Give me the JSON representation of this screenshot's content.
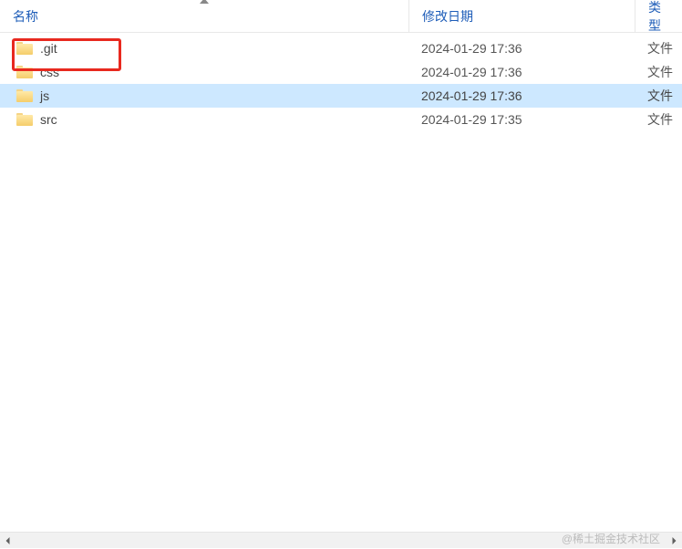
{
  "columns": {
    "name": "名称",
    "modified": "修改日期",
    "type": "类型"
  },
  "files": [
    {
      "name": ".git",
      "modified": "2024-01-29 17:36",
      "type": "文件",
      "selected": false,
      "highlighted": true
    },
    {
      "name": "css",
      "modified": "2024-01-29 17:36",
      "type": "文件",
      "selected": false,
      "highlighted": false
    },
    {
      "name": "js",
      "modified": "2024-01-29 17:36",
      "type": "文件",
      "selected": true,
      "highlighted": false
    },
    {
      "name": "src",
      "modified": "2024-01-29 17:35",
      "type": "文件",
      "selected": false,
      "highlighted": false
    }
  ],
  "watermark": "@稀土掘金技术社区"
}
